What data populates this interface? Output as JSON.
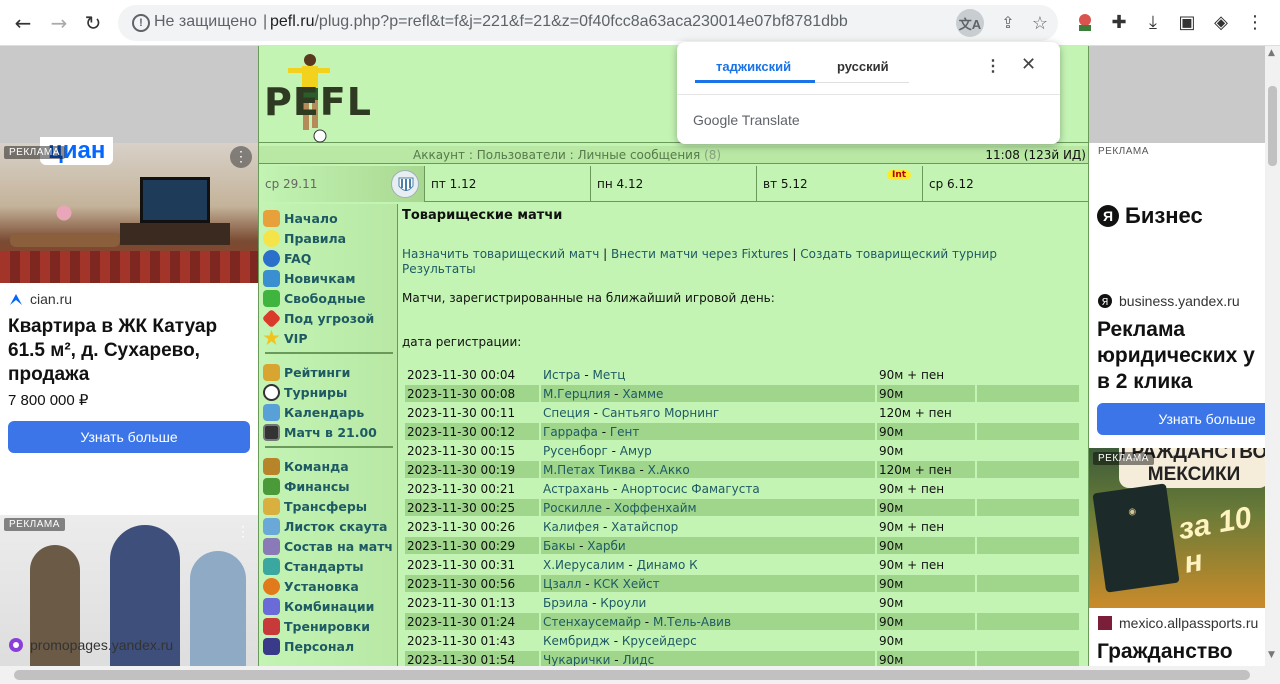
{
  "browser": {
    "insecure_label": "Не защищено",
    "separator": "|",
    "url_host": "pefl.ru",
    "url_path": "/plug.php?p=refl&t=f&j=221&f=21&z=0f40fcc8a63aca230014e07bf8781dbb"
  },
  "translate_popup": {
    "tab_source": "таджикский",
    "tab_target": "русский",
    "more": "⋮",
    "close": "✕",
    "brand": "Google Translate"
  },
  "ad_left": {
    "tag": "РЕКЛАМА",
    "logo": "циан",
    "domain": "cian.ru",
    "title": "Квартира в ЖК Катуар 61.5 м², д. Сухарево, продажа",
    "price": "7 800 000 ₽",
    "button": "Узнать больше",
    "tag2": "РЕКЛАМА",
    "domain2": "promopages.yandex.ru"
  },
  "ad_right": {
    "tag": "РЕКЛАМА",
    "brand": "Бизнес",
    "domain": "business.yandex.ru",
    "title_lines": [
      "Реклама",
      "юридических у",
      "в 2 клика"
    ],
    "button": "Узнать больше",
    "tag2": "РЕКЛАМА",
    "banner": "ГРАЖДАНСТВО МЕКСИКИ",
    "banner_za": "за 10 н",
    "domain2": "mexico.allpassports.ru",
    "title2": "Гражданство"
  },
  "pefl": {
    "logo": "PEFL",
    "topbar": {
      "account": "Аккаунт",
      "users": "Пользователи",
      "messages": "Личные сообщения",
      "messages_count": "(8)",
      "sep": ":",
      "clock": "11:08 (123й ИД)"
    },
    "days": [
      {
        "label": "ср 29.11"
      },
      {
        "label": "пт 1.12"
      },
      {
        "label": "пн 4.12"
      },
      {
        "label": "вт 5.12"
      },
      {
        "label": "ср 6.12"
      }
    ],
    "int_badge": "Int",
    "nav": [
      {
        "label": "Начало"
      },
      {
        "label": "Правила"
      },
      {
        "label": "FAQ"
      },
      {
        "label": "Новичкам"
      },
      {
        "label": "Свободные"
      },
      {
        "label": "Под угрозой"
      },
      {
        "label": "VIP"
      },
      {
        "label": "Рейтинги"
      },
      {
        "label": "Турниры"
      },
      {
        "label": "Календарь"
      },
      {
        "label": "Матч в 21.00"
      },
      {
        "label": "Команда"
      },
      {
        "label": "Финансы"
      },
      {
        "label": "Трансферы"
      },
      {
        "label": "Листок скаута"
      },
      {
        "label": "Состав на матч"
      },
      {
        "label": "Стандарты"
      },
      {
        "label": "Установка"
      },
      {
        "label": "Комбинации"
      },
      {
        "label": "Тренировки"
      },
      {
        "label": "Персонал"
      }
    ],
    "page_title": "Товарищеские матчи",
    "actions": {
      "assign": "Назначить товарищеский матч",
      "fixtures": "Внести матчи через Fixtures",
      "create": "Создать товарищеский турнир",
      "results": "Результаты",
      "sep": "|"
    },
    "lead": "Матчи, зарегистрированные на ближайший игровой день:",
    "reg_label": "дата регистрации:",
    "matches": [
      {
        "date": "2023-11-30 00:04",
        "home": "Истра",
        "away": "Метц",
        "type": "90м + пен"
      },
      {
        "date": "2023-11-30 00:08",
        "home": "М.Герцлия",
        "away": "Хамме",
        "type": "90м"
      },
      {
        "date": "2023-11-30 00:11",
        "home": "Специя",
        "away": "Сантьяго Морнинг",
        "type": "120м + пен"
      },
      {
        "date": "2023-11-30 00:12",
        "home": "Гаррафа",
        "away": "Гент",
        "type": "90м"
      },
      {
        "date": "2023-11-30 00:15",
        "home": "Русенборг",
        "away": "Амур",
        "type": "90м"
      },
      {
        "date": "2023-11-30 00:19",
        "home": "М.Петах Тиква",
        "away": "Х.Акко",
        "type": "120м + пен"
      },
      {
        "date": "2023-11-30 00:21",
        "home": "Астрахань",
        "away": "Анортосис Фамагуста",
        "type": "90м + пен"
      },
      {
        "date": "2023-11-30 00:25",
        "home": "Роскилле",
        "away": "Хоффенхайм",
        "type": "90м"
      },
      {
        "date": "2023-11-30 00:26",
        "home": "Калифея",
        "away": "Хатайспор",
        "type": "90м + пен"
      },
      {
        "date": "2023-11-30 00:29",
        "home": "Бакы",
        "away": "Харби",
        "type": "90м"
      },
      {
        "date": "2023-11-30 00:31",
        "home": "Х.Иерусалим",
        "away": "Динамо К",
        "type": "90м + пен"
      },
      {
        "date": "2023-11-30 00:56",
        "home": "Цзалл",
        "away": "КСК Хейст",
        "type": "90м"
      },
      {
        "date": "2023-11-30 01:13",
        "home": "Брэила",
        "away": "Кроули",
        "type": "90м"
      },
      {
        "date": "2023-11-30 01:24",
        "home": "Стенхаусемайр",
        "away": "М.Тель-Авив",
        "type": "90м"
      },
      {
        "date": "2023-11-30 01:43",
        "home": "Кембридж",
        "away": "Крусейдерс",
        "type": "90м"
      },
      {
        "date": "2023-11-30 01:54",
        "home": "Чукарички",
        "away": "Лидс",
        "type": "90м"
      }
    ]
  },
  "colors": {
    "pefl_bg": "#c4f4b4",
    "row_stripe": "#9fd68c",
    "link": "#1e5a64",
    "accent": "#1a73e8"
  }
}
